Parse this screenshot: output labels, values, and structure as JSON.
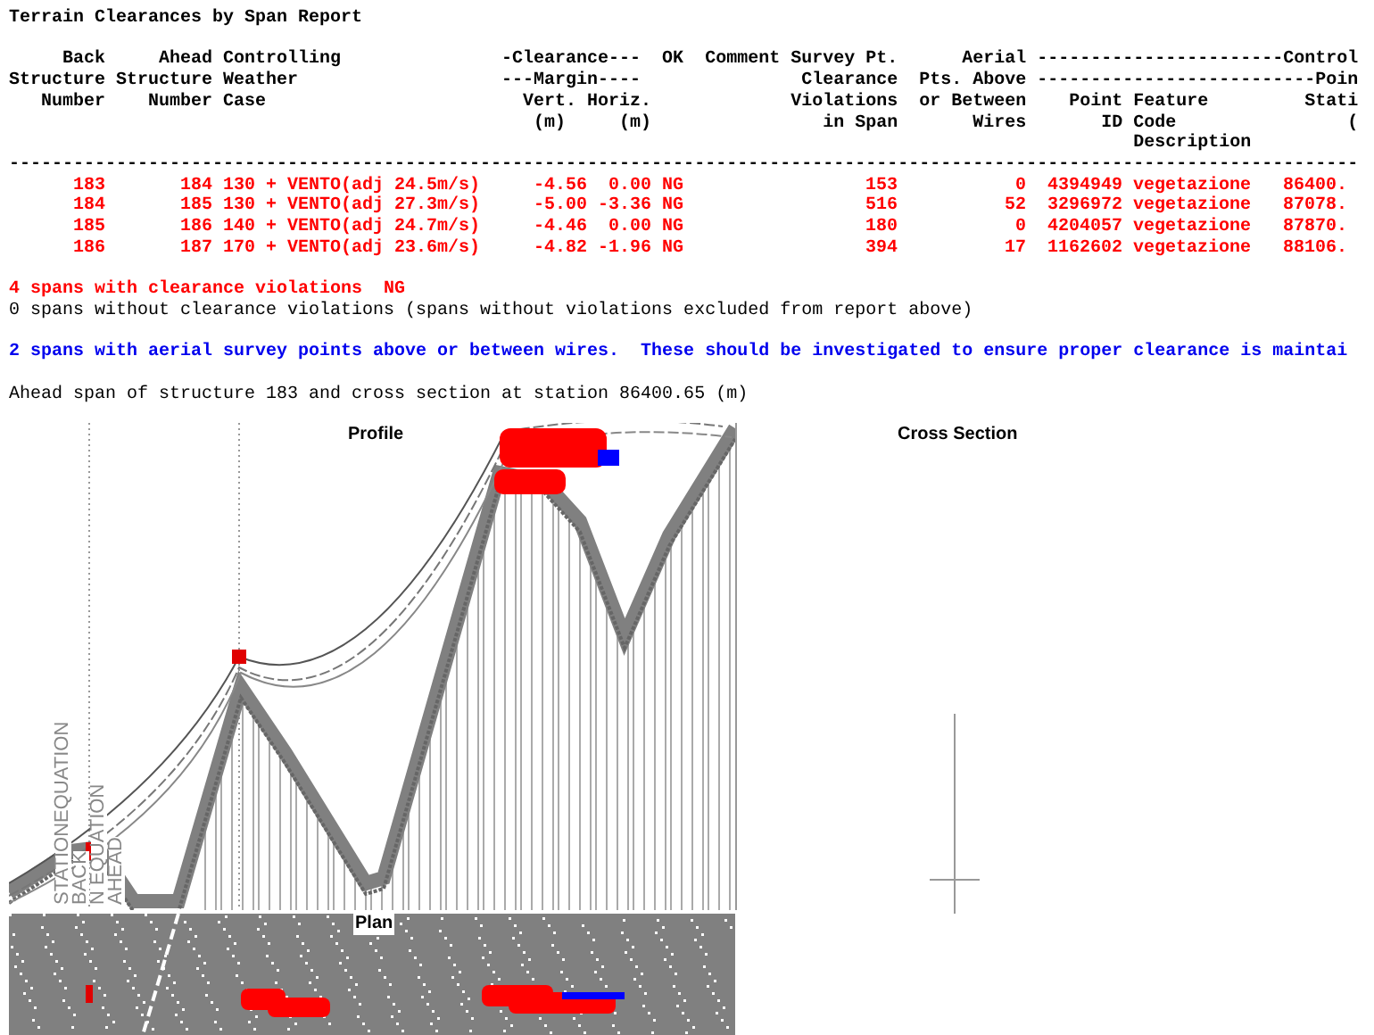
{
  "report": {
    "title": "Terrain Clearances by Span Report",
    "header_lines": [
      "     Back     Ahead Controlling               -Clearance---  OK  Comment Survey Pt.      Aerial -----------------------Control",
      "Structure Structure Weather                   ---Margin----               Clearance  Pts. Above --------------------------Poin",
      "   Number    Number Case                        Vert. Horiz.             Violations  or Between    Point Feature         Stati",
      "                                                 (m)     (m)                in Span       Wires       ID Code                (",
      "                                                                                                         Description",
      "------------------------------------------------------------------------------------------------------------------------------"
    ],
    "rows": [
      {
        "back": "183",
        "ahead": "184",
        "case": "130 + VENTO(adj 24.5m/s)",
        "vert": "-4.56",
        "horiz": "0.00",
        "ok": "NG",
        "violations": "153",
        "aerial": "0",
        "point_id": "4394949",
        "feature": "vegetazione",
        "station": "86400."
      },
      {
        "back": "184",
        "ahead": "185",
        "case": "130 + VENTO(adj 27.3m/s)",
        "vert": "-5.00",
        "horiz": "-3.36",
        "ok": "NG",
        "violations": "516",
        "aerial": "52",
        "point_id": "3296972",
        "feature": "vegetazione",
        "station": "87078."
      },
      {
        "back": "185",
        "ahead": "186",
        "case": "140 + VENTO(adj 24.7m/s)",
        "vert": "-4.46",
        "horiz": "0.00",
        "ok": "NG",
        "violations": "180",
        "aerial": "0",
        "point_id": "4204057",
        "feature": "vegetazione",
        "station": "87870."
      },
      {
        "back": "186",
        "ahead": "187",
        "case": "170 + VENTO(adj 23.6m/s)",
        "vert": "-4.82",
        "horiz": "-1.96",
        "ok": "NG",
        "violations": "394",
        "aerial": "17",
        "point_id": "1162602",
        "feature": "vegetazione",
        "station": "88106."
      }
    ],
    "summary": [
      {
        "kind": "violation",
        "text": "4 spans with clearance violations  NG"
      },
      {
        "kind": "plain",
        "text": "0 spans without clearance violations (spans without violations excluded from report above)"
      },
      {
        "kind": "gap"
      },
      {
        "kind": "aerial",
        "text": "2 spans with aerial survey points above or between wires.  These should be investigated to ensure proper clearance is maintai"
      },
      {
        "kind": "gap"
      },
      {
        "kind": "plain",
        "text": "Ahead span of structure 183 and cross section at station 86400.65 (m)"
      }
    ]
  },
  "plots": {
    "profile": {
      "title": "Profile",
      "station_labels": [
        "STATIONEQUATION",
        "BACK",
        "N EQUATION",
        "AHEAD"
      ]
    },
    "plan": {
      "title": "Plan"
    },
    "cross_section": {
      "title": "Cross Section"
    }
  }
}
